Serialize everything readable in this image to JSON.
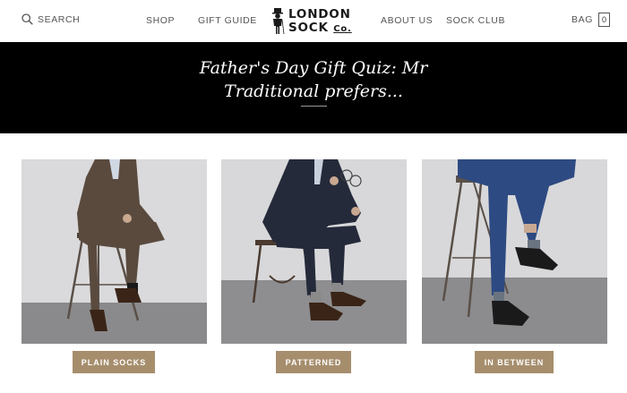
{
  "header": {
    "search_label": "SEARCH",
    "search_icon": "search-icon",
    "nav": {
      "shop": "SHOP",
      "gift_guide": "GIFT GUIDE",
      "about_us": "ABOUT US",
      "sock_club": "SOCK CLUB"
    },
    "logo": {
      "line1": "LONDON",
      "line2": "SOCK",
      "co": "Co.",
      "icon": "gentleman-logo-icon"
    },
    "bag": {
      "label": "BAG",
      "count": "0",
      "icon": "bag-icon"
    }
  },
  "banner": {
    "title": "Father's Day Gift Quiz: Mr Traditional prefers..."
  },
  "choices": [
    {
      "label": "PLAIN SOCKS",
      "image": "man-brown-suit-on-stool"
    },
    {
      "label": "PATTERNED",
      "image": "man-navy-suit-with-glasses"
    },
    {
      "label": "IN BETWEEN",
      "image": "man-blue-trousers-crossed-legs"
    }
  ],
  "colors": {
    "banner_bg": "#000000",
    "button_bg": "#a68e6d",
    "button_text": "#ffffff",
    "photo_bg": "#d8d8da"
  }
}
